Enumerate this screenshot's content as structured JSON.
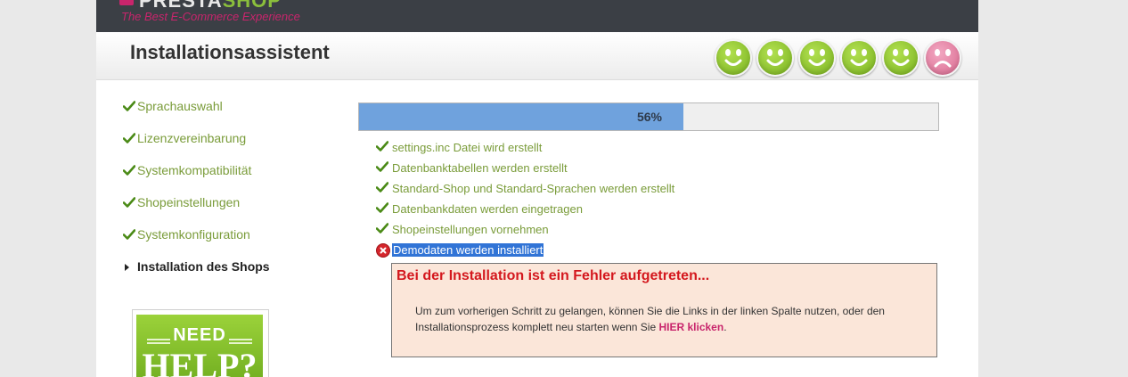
{
  "brand": {
    "logo_text_a": "PRESTA",
    "logo_text_b": "SHOP",
    "tagline": "The Best E-Commerce Experience",
    "accent": "#c8256c",
    "green": "#8bbf3c"
  },
  "header": {
    "title": "Installationsassistent",
    "smileys": [
      "happy",
      "happy",
      "happy",
      "happy",
      "happy",
      "sad"
    ]
  },
  "sidebar": {
    "items": [
      {
        "label": "Sprachauswahl",
        "state": "done"
      },
      {
        "label": "Lizenzvereinbarung",
        "state": "done"
      },
      {
        "label": "Systemkompatibilität",
        "state": "done"
      },
      {
        "label": "Shopeinstellungen",
        "state": "done"
      },
      {
        "label": "Systemkonfiguration",
        "state": "done"
      },
      {
        "label": "Installation des Shops",
        "state": "current"
      }
    ],
    "help": {
      "need": "NEED",
      "help": "HELP?"
    }
  },
  "progress": {
    "label": "56%",
    "value": 0.56,
    "color": "#6fa2dd"
  },
  "steps": [
    {
      "label": "settings.inc Datei wird erstellt",
      "state": "done"
    },
    {
      "label": "Datenbanktabellen werden erstellt",
      "state": "done"
    },
    {
      "label": "Standard-Shop und Standard-Sprachen werden erstellt",
      "state": "done"
    },
    {
      "label": "Datenbankdaten werden eingetragen",
      "state": "done"
    },
    {
      "label": "Shopeinstellungen vornehmen",
      "state": "done"
    },
    {
      "label": "Demodaten werden installiert",
      "state": "error"
    }
  ],
  "error": {
    "title": "Bei der Installation ist ein Fehler aufgetreten...",
    "text_before": "Um zum vorherigen Schritt zu gelangen, können Sie die Links in der linken Spalte nutzen, oder den Installationsprozess komplett neu starten wenn Sie ",
    "link": "HIER klicken",
    "text_after": "."
  }
}
